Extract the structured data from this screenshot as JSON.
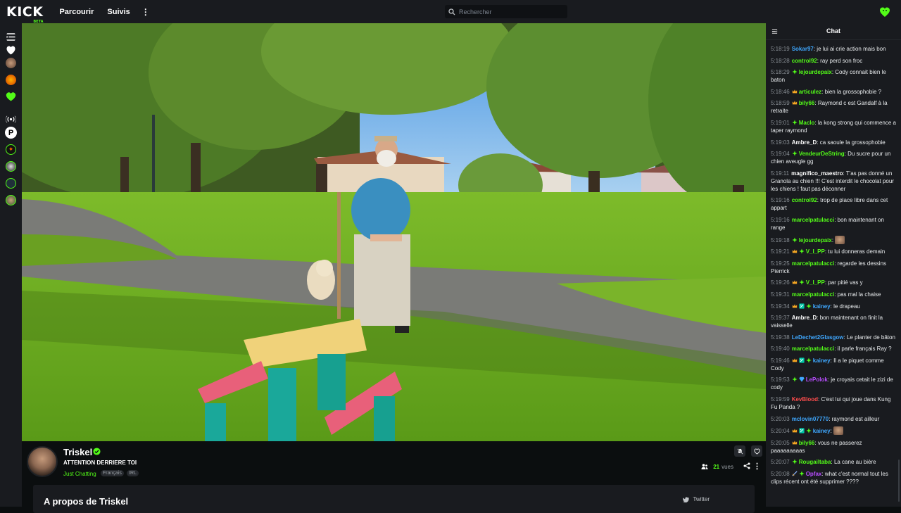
{
  "header": {
    "logo": "KICK",
    "logo_badge": "BETA",
    "nav": [
      {
        "label": "Parcourir"
      },
      {
        "label": "Suivis"
      }
    ],
    "more": "⋮",
    "search_placeholder": "Rechercher"
  },
  "stream": {
    "streamer": "Triskel",
    "title": "ATTENTION DERRIERE TOI",
    "category": "Just Chatting",
    "tags": [
      "Français",
      "IRL"
    ],
    "viewer_count": "21",
    "viewer_label": "vues",
    "about_title": "A propos de Triskel",
    "twitter_label": "Twitter"
  },
  "chat": {
    "title": "Chat",
    "messages": [
      {
        "ts": "5:18:19",
        "user": "Sokar97",
        "color": "#3fa8ff",
        "badges": [],
        "text": "je lui ai crie action mais bon"
      },
      {
        "ts": "5:18:28",
        "user": "control92",
        "color": "#53fc18",
        "badges": [],
        "text": "ray perd son froc"
      },
      {
        "ts": "5:18:29",
        "user": "lejourdepaix",
        "color": "#53fc18",
        "badges": [
          "sub"
        ],
        "text": "Cody connait bien le baton"
      },
      {
        "ts": "5:18:46",
        "user": "articulez",
        "color": "#53fc18",
        "badges": [
          "crown"
        ],
        "text": "bien la grossophobie ?"
      },
      {
        "ts": "5:18:59",
        "user": "bily66",
        "color": "#53fc18",
        "badges": [
          "crown"
        ],
        "text": "Raymond c est Gandalf à la retraite"
      },
      {
        "ts": "5:19:01",
        "user": "Maclo",
        "color": "#53fc18",
        "badges": [
          "sub"
        ],
        "text": "la kong strong qui commence a taper raymond"
      },
      {
        "ts": "5:19:03",
        "user": "Ambre_D",
        "color": "#ffffff",
        "badges": [],
        "text": "ca saoule la grossophobie"
      },
      {
        "ts": "5:19:04",
        "user": "VendeurDeString",
        "color": "#53fc18",
        "badges": [
          "sub"
        ],
        "text": "Du sucre pour un chien aveugle gg"
      },
      {
        "ts": "5:19:11",
        "user": "magnifico_maestro",
        "color": "#ffffff",
        "badges": [],
        "text": "T'as pas donné un Granola au chien !!! C'est interdit le chocolat pour les chiens ! faut pas déconner"
      },
      {
        "ts": "5:19:16",
        "user": "control92",
        "color": "#53fc18",
        "badges": [],
        "text": "trop de place libre dans cet appart"
      },
      {
        "ts": "5:19:16",
        "user": "marcelpatulacci",
        "color": "#53fc18",
        "badges": [],
        "text": "bon maintenant on range"
      },
      {
        "ts": "5:19:18",
        "user": "lejourdepaix",
        "color": "#53fc18",
        "badges": [
          "sub"
        ],
        "text": "",
        "emote": true
      },
      {
        "ts": "5:19:21",
        "user": "V_I_PP",
        "color": "#53fc18",
        "badges": [
          "crown",
          "sub"
        ],
        "text": "tu lui donneras demain"
      },
      {
        "ts": "5:19:25",
        "user": "marcelpatulacci",
        "color": "#53fc18",
        "badges": [],
        "text": "regarde les dessins Pierrick"
      },
      {
        "ts": "5:19:26",
        "user": "V_I_PP",
        "color": "#53fc18",
        "badges": [
          "crown",
          "sub"
        ],
        "text": "par pitié vas y"
      },
      {
        "ts": "5:19:31",
        "user": "marcelpatulacci",
        "color": "#53fc18",
        "badges": [],
        "text": "pas mal la chaise"
      },
      {
        "ts": "5:19:34",
        "user": "kainey",
        "color": "#3fa8ff",
        "badges": [
          "crown",
          "mod",
          "sub"
        ],
        "text": "le drapeau"
      },
      {
        "ts": "5:19:37",
        "user": "Ambre_D",
        "color": "#ffffff",
        "badges": [],
        "text": "bon maintenant on finit la vaisselle"
      },
      {
        "ts": "5:19:38",
        "user": "LeDechet2Glasgow",
        "color": "#3fa8ff",
        "badges": [],
        "text": "Le planter de bâton"
      },
      {
        "ts": "5:19:40",
        "user": "marcelpatulacci",
        "color": "#53fc18",
        "badges": [],
        "text": "il parle français Ray ?"
      },
      {
        "ts": "5:19:46",
        "user": "kainey",
        "color": "#3fa8ff",
        "badges": [
          "crown",
          "mod",
          "sub"
        ],
        "text": "Il a le piquet comme Cody"
      },
      {
        "ts": "5:19:53",
        "user": "LePolok",
        "color": "#b84dff",
        "badges": [
          "sub",
          "gem"
        ],
        "text": "je croyais cetait le zizi de cody"
      },
      {
        "ts": "5:19:59",
        "user": "KevBlood",
        "color": "#ff4d4d",
        "badges": [],
        "text": "C'est lui qui joue dans Kung Fu Panda ?"
      },
      {
        "ts": "5:20:03",
        "user": "mclovin07770",
        "color": "#3fa8ff",
        "badges": [],
        "text": "raymond est ailleur"
      },
      {
        "ts": "5:20:04",
        "user": "kainey",
        "color": "#3fa8ff",
        "badges": [
          "crown",
          "mod",
          "sub"
        ],
        "text": "",
        "emote": true
      },
      {
        "ts": "5:20:05",
        "user": "bily66",
        "color": "#53fc18",
        "badges": [
          "crown"
        ],
        "text": "vous ne passerez paaaaaaaaas"
      },
      {
        "ts": "5:20:07",
        "user": "Rougailtaba",
        "color": "#53fc18",
        "badges": [
          "sub"
        ],
        "text": "La cane au bière"
      },
      {
        "ts": "5:20:08",
        "user": "Opfax",
        "color": "#b84dff",
        "badges": [
          "sword",
          "sub"
        ],
        "text": "what c'est normal tout les clips récent ont été supprimer ????"
      }
    ]
  }
}
